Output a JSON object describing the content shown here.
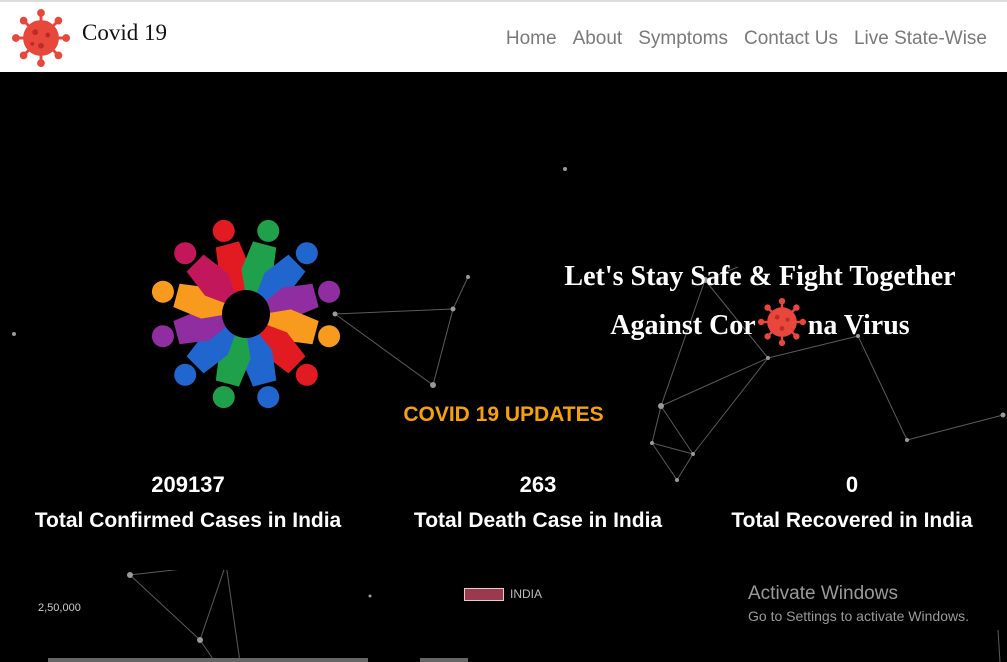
{
  "brand": {
    "name": "Covid 19",
    "logo_icon": "virus-icon",
    "accent": "#e8473c"
  },
  "nav": {
    "items": [
      "Home",
      "About",
      "Symptoms",
      "Contact Us",
      "Live State-Wise"
    ]
  },
  "hero": {
    "logo_icon": "people-circle-icon",
    "tagline_line1": "Let's Stay Safe & Fight Together",
    "tagline_line2_before": "Against Cor",
    "tagline_line2_after": "na Virus",
    "tagline_icon": "virus-icon"
  },
  "updates": {
    "heading": "COVID 19 UPDATES",
    "heading_color": "#f5a20a",
    "stats": [
      {
        "value": "209137",
        "label": "Total Confirmed Cases in India"
      },
      {
        "value": "263",
        "label": "Total Death Case in India"
      },
      {
        "value": "0",
        "label": "Total Recovered in India"
      }
    ]
  },
  "chart": {
    "tick_label": "2,50,000",
    "legend_label": "INDIA",
    "series_color": "#9b3a4e"
  },
  "watermark": {
    "title": "Activate Windows",
    "subtitle": "Go to Settings to activate Windows."
  }
}
